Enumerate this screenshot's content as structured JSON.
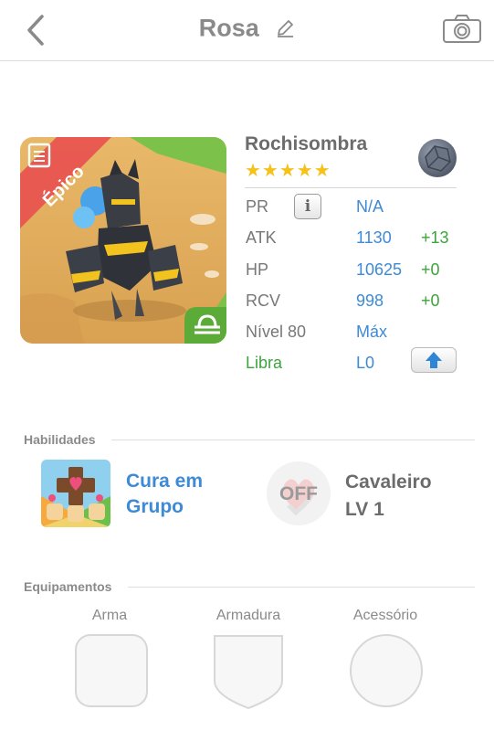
{
  "header": {
    "title": "Rosa"
  },
  "monster": {
    "name": "Rochisombra",
    "stars": "★★★★★",
    "rarity": "Épico",
    "accent": "#e8534f"
  },
  "stats": {
    "pr": {
      "label": "PR",
      "value": "N/A"
    },
    "atk": {
      "label": "ATK",
      "value": "1130",
      "bonus": "+13"
    },
    "hp": {
      "label": "HP",
      "value": "10625",
      "bonus": "+0"
    },
    "rcv": {
      "label": "RCV",
      "value": "998",
      "bonus": "+0"
    },
    "level": {
      "label": "Nível 80",
      "value": "Máx"
    },
    "zodiac": {
      "label": "Libra",
      "value": "L0"
    }
  },
  "skills": {
    "heading": "Habilidades",
    "active": "Cura em Grupo",
    "leader_badge": "OFF",
    "leader_line1": "Cavaleiro",
    "leader_line2": "LV 1"
  },
  "equipment": {
    "heading": "Equipamentos",
    "weapon": "Arma",
    "armor": "Armadura",
    "accessory": "Acessório"
  },
  "colors": {
    "link_blue": "#3d8ad6",
    "bonus_green": "#3aa53a",
    "star_gold": "#f6c21a"
  }
}
